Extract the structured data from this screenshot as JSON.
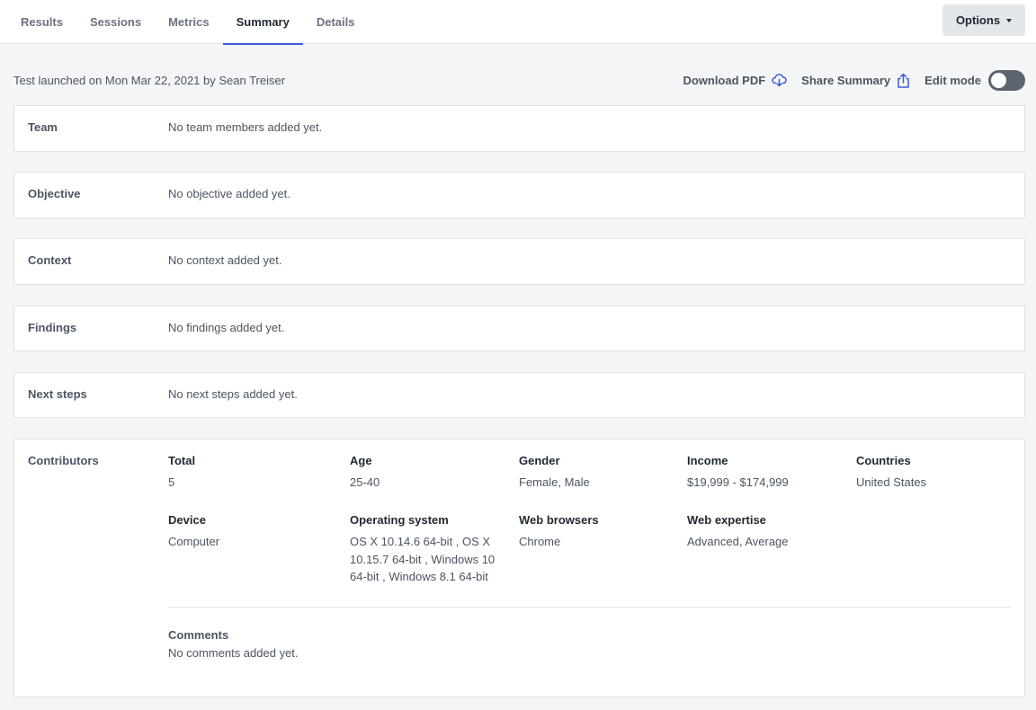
{
  "tabs": [
    {
      "label": "Results"
    },
    {
      "label": "Sessions"
    },
    {
      "label": "Metrics"
    },
    {
      "label": "Summary",
      "active": true
    },
    {
      "label": "Details"
    }
  ],
  "options_label": "Options",
  "launched_text": "Test launched on Mon Mar 22, 2021 by Sean Treiser",
  "actions": {
    "download_label": "Download PDF",
    "share_label": "Share Summary",
    "edit_label": "Edit mode"
  },
  "sections": [
    {
      "label": "Team",
      "value": "No team members added yet."
    },
    {
      "label": "Objective",
      "value": "No objective added yet."
    },
    {
      "label": "Context",
      "value": "No context added yet."
    },
    {
      "label": "Findings",
      "value": "No findings added yet."
    },
    {
      "label": "Next steps",
      "value": "No next steps added yet."
    }
  ],
  "contributors": {
    "label": "Contributors",
    "fields": [
      {
        "title": "Total",
        "value": "5"
      },
      {
        "title": "Age",
        "value": "25-40"
      },
      {
        "title": "Gender",
        "value": "Female, Male"
      },
      {
        "title": "Income",
        "value": "$19,999 - $174,999"
      },
      {
        "title": "Countries",
        "value": "United States"
      },
      {
        "title": "Device",
        "value": "Computer"
      },
      {
        "title": "Operating system",
        "value": "OS X 10.14.6 64-bit , OS X 10.15.7 64-bit , Windows 10 64-bit , Windows 8.1 64-bit"
      },
      {
        "title": "Web browsers",
        "value": "Chrome"
      },
      {
        "title": "Web expertise",
        "value": "Advanced, Average"
      }
    ],
    "comments_title": "Comments",
    "comments_value": "No comments added yet."
  }
}
